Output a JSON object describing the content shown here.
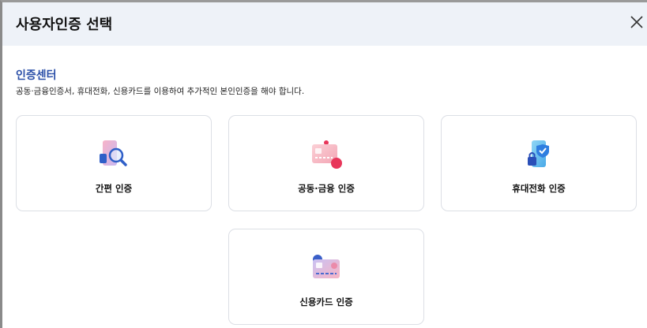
{
  "header": {
    "title": "사용자인증 선택",
    "close_label": "×"
  },
  "section": {
    "title": "인증센터",
    "description": "공동·금융인증서, 휴대전화, 신용카드를 이용하여 추가적인 본인인증을 해야 합니다."
  },
  "options": [
    {
      "label": "간편 인증",
      "icon": "simple-auth-icon"
    },
    {
      "label": "공동·금융 인증",
      "icon": "certificate-icon"
    },
    {
      "label": "휴대전화 인증",
      "icon": "phone-auth-icon"
    },
    {
      "label": "신용카드 인증",
      "icon": "credit-card-icon"
    }
  ],
  "colors": {
    "header_bg": "#eef2f8",
    "section_title": "#2b4fa8",
    "card_border": "#dcdfe5"
  }
}
